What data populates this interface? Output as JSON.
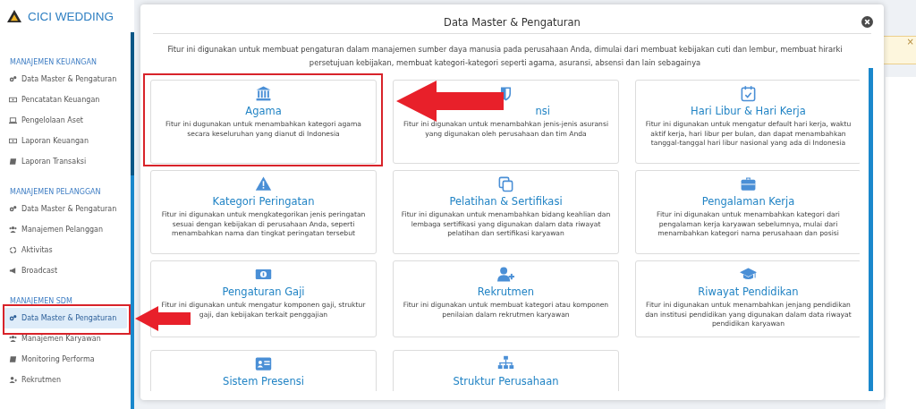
{
  "brand": {
    "name": "CICI WEDDING"
  },
  "sidebar": {
    "groups": [
      {
        "heading": "MANAJEMEN KEUANGAN",
        "items": [
          {
            "label": "Data Master & Pengaturan",
            "selected": false
          },
          {
            "label": "Pencatatan Keuangan",
            "selected": false
          },
          {
            "label": "Pengelolaan Aset",
            "selected": false
          },
          {
            "label": "Laporan Keuangan",
            "selected": false
          },
          {
            "label": "Laporan Transaksi",
            "selected": false
          }
        ]
      },
      {
        "heading": "MANAJEMEN PELANGGAN",
        "items": [
          {
            "label": "Data Master & Pengaturan",
            "selected": false
          },
          {
            "label": "Manajemen Pelanggan",
            "selected": false
          },
          {
            "label": "Aktivitas",
            "selected": false
          },
          {
            "label": "Broadcast",
            "selected": false
          }
        ]
      },
      {
        "heading": "MANAJEMEN SDM",
        "items": [
          {
            "label": "Data Master & Pengaturan",
            "selected": true
          },
          {
            "label": "Manajemen Karyawan",
            "selected": false
          },
          {
            "label": "Monitoring Performa",
            "selected": false
          },
          {
            "label": "Rekrutmen",
            "selected": false
          }
        ]
      }
    ]
  },
  "background_alert": {
    "close": "×"
  },
  "modal": {
    "title": "Data Master & Pengaturan",
    "intro": "Fitur ini digunakan untuk membuat pengaturan dalam manajemen sumber daya manusia pada perusahaan Anda, dimulai dari membuat kebijakan cuti dan lembur, membuat hirarki persetujuan kebijakan, membuat kategori-kategori seperti agama, asuransi, absensi dan lain sebagainya",
    "cards": [
      {
        "title": "Agama",
        "description": "Fitur ini dugunakan untuk menambahkan kategori agama secara keseluruhan yang dianut di Indonesia"
      },
      {
        "title": "nsi",
        "description": "Fitur ini digunakan untuk menambahkan jenis-jenis asuransi yang digunakan oleh perusahaan dan tim Anda"
      },
      {
        "title": "Hari Libur & Hari Kerja",
        "description": "Fitur ini digunakan untuk mengatur default hari kerja, waktu aktif kerja, hari libur per bulan, dan dapat menambahkan tanggal-tanggal hari libur nasional yang ada di Indonesia"
      },
      {
        "title": "Kategori Peringatan",
        "description": "Fitur ini digunakan untuk mengkategorikan jenis peringatan sesuai dengan kebijakan di perusahaan Anda, seperti menambahkan nama dan tingkat peringatan tersebut"
      },
      {
        "title": "Pelatihan & Sertifikasi",
        "description": "Fitur ini digunakan untuk menambahkan bidang keahlian dan lembaga sertifikasi yang digunakan dalam data riwayat pelatihan dan sertifikasi karyawan"
      },
      {
        "title": "Pengalaman Kerja",
        "description": "Fitur ini digunakan untuk menambahkan kategori dari pengalaman kerja karyawan sebelumnya, mulai dari menambahkan kategori nama perusahaan dan posisi"
      },
      {
        "title": "Pengaturan Gaji",
        "description": "Fitur ini digunakan untuk mengatur komponen gaji, struktur gaji, dan kebijakan terkait penggajian"
      },
      {
        "title": "Rekrutmen",
        "description": "Fitur ini digunakan untuk membuat kategori atau komponen penilaian dalam rekrutmen karyawan"
      },
      {
        "title": "Riwayat Pendidikan",
        "description": "Fitur ini digunakan untuk menambahkan jenjang pendidikan dan institusi pendidikan yang digunakan dalam data riwayat pendidikan karyawan"
      },
      {
        "title": "Sistem Presensi"
      },
      {
        "title": "Struktur Perusahaan"
      }
    ]
  }
}
